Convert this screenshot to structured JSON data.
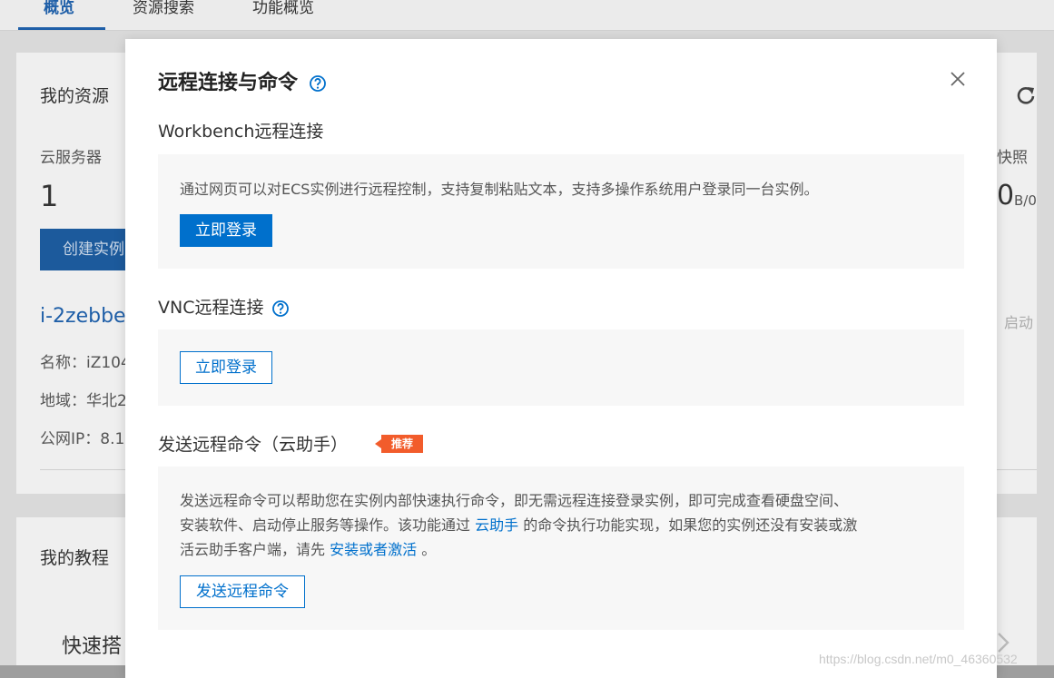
{
  "background": {
    "tabs": [
      "概览",
      "资源搜索",
      "功能概览"
    ],
    "resources_title": "我的资源",
    "servers_label": "云服务器",
    "servers_count": "1",
    "create_button": "创建实例",
    "instance_id": "i-2zebbe",
    "name_label": "名称：iZ104",
    "region_label": "地域：华北2",
    "public_ip_label": "公网IP：8.1",
    "snapshot_label": "快照",
    "snapshot_value": "0",
    "snapshot_unit": "B/0",
    "start_label": "启动",
    "tutorials_title": "我的教程",
    "quick_build": "快速搭",
    "watermark": "https://blog.csdn.net/m0_46360532"
  },
  "modal": {
    "title": "远程连接与命令",
    "workbench": {
      "title": "Workbench远程连接",
      "description": "通过网页可以对ECS实例进行远程控制，支持复制粘贴文本，支持多操作系统用户登录同一台实例。",
      "button": "立即登录"
    },
    "vnc": {
      "title": "VNC远程连接",
      "button": "立即登录"
    },
    "command": {
      "title": "发送远程命令（云助手）",
      "badge": "推荐",
      "line1": "发送远程命令可以帮助您在实例内部快速执行命令，即无需远程连接登录实例，即可完成查看硬盘空间、",
      "line2_a": "安装软件、启动停止服务等操作。该功能通过 ",
      "line2_link": "云助手",
      "line2_b": " 的命令执行功能实现，如果您的实例还没有安装或激",
      "line3_a": "活云助手客户端，请先 ",
      "line3_link": "安装或者激活",
      "line3_b": " 。",
      "button": "发送远程命令"
    }
  },
  "colors": {
    "accent": "#0070cc",
    "badge": "#f25c2b",
    "panel_bg": "#f7f7f7"
  },
  "icons": [
    "help-icon",
    "close-icon",
    "refresh-icon",
    "chevron-right-icon"
  ]
}
